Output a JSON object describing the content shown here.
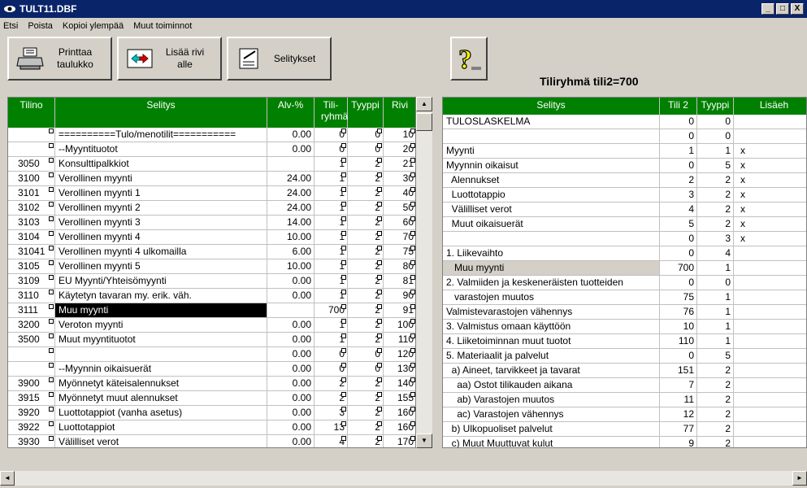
{
  "window": {
    "title": "TULT11.DBF",
    "min": "_",
    "max": "□",
    "close": "X"
  },
  "menu": [
    "Etsi",
    "Poista",
    "Kopioi ylempää",
    "Muut toiminnot"
  ],
  "toolbar": {
    "print": [
      "Printtaa",
      "taulukko"
    ],
    "addrow": [
      "Lisää rivi",
      "alle"
    ],
    "explain": "Selitykset"
  },
  "group_title": "Tiliryhmä tili2=700",
  "left": {
    "headers": [
      "Tilino",
      "Selitys",
      "Alv-%",
      "Tili-ryhmä",
      "Tyyppi",
      "Rivi"
    ],
    "rows": [
      [
        "",
        "==========Tulo/menotilit===========",
        "0.00",
        "0",
        "0",
        "10"
      ],
      [
        "",
        "--Myyntituotot",
        "0.00",
        "0",
        "0",
        "20"
      ],
      [
        "3050",
        "Konsulttipalkkiot",
        "",
        "1",
        "2",
        "21"
      ],
      [
        "3100",
        "Verollinen myynti",
        "24.00",
        "1",
        "2",
        "30"
      ],
      [
        "3101",
        "Verollinen myynti 1",
        "24.00",
        "1",
        "2",
        "40"
      ],
      [
        "3102",
        "Verollinen myynti 2",
        "24.00",
        "1",
        "2",
        "50"
      ],
      [
        "3103",
        "Verollinen myynti 3",
        "14.00",
        "1",
        "2",
        "60"
      ],
      [
        "3104",
        "Verollinen myynti 4",
        "10.00",
        "1",
        "2",
        "70"
      ],
      [
        "31041",
        "Verollinen myynti 4 ulkomailla",
        "6.00",
        "1",
        "2",
        "75"
      ],
      [
        "3105",
        "Verollinen myynti 5",
        "10.00",
        "1",
        "2",
        "80"
      ],
      [
        "3109",
        "EU Myynti/Yhteisömyynti",
        "0.00",
        "1",
        "2",
        "81"
      ],
      [
        "3110",
        "Käytetyn tavaran my. erik. väh.",
        "0.00",
        "1",
        "2",
        "90"
      ],
      [
        "3111",
        "Muu myynti",
        "",
        "700",
        "2",
        "91"
      ],
      [
        "3200",
        "Veroton myynti",
        "0.00",
        "1",
        "2",
        "100"
      ],
      [
        "3500",
        "Muut myyntituotot",
        "0.00",
        "1",
        "2",
        "110"
      ],
      [
        "",
        "",
        "0.00",
        "0",
        "0",
        "120"
      ],
      [
        "",
        "--Myynnin oikaisuerät",
        "0.00",
        "0",
        "0",
        "130"
      ],
      [
        "3900",
        "Myönnetyt käteisalennukset",
        "0.00",
        "2",
        "2",
        "140"
      ],
      [
        "3915",
        "Myönnetyt muut alennukset",
        "0.00",
        "2",
        "2",
        "155"
      ],
      [
        "3920",
        "Luottotappiot (vanha asetus)",
        "0.00",
        "3",
        "2",
        "160"
      ],
      [
        "3922",
        "Luottotappiot",
        "0.00",
        "13",
        "2",
        "160"
      ],
      [
        "3930",
        "Välilliset verot",
        "0.00",
        "4",
        "2",
        "170"
      ]
    ]
  },
  "right": {
    "headers": [
      "Selitys",
      "Tili 2",
      "Tyyppi",
      "Lisäeh"
    ],
    "rows": [
      [
        "TULOSLASKELMA",
        "0",
        "0",
        ""
      ],
      [
        "",
        "0",
        "0",
        ""
      ],
      [
        "Myynti",
        "1",
        "1",
        "x"
      ],
      [
        "Myynnin oikaisut",
        "0",
        "5",
        "x"
      ],
      [
        "  Alennukset",
        "2",
        "2",
        "x"
      ],
      [
        "  Luottotappio",
        "3",
        "2",
        "x"
      ],
      [
        "  Välilliset verot",
        "4",
        "2",
        "x"
      ],
      [
        "  Muut oikaisuerät",
        "5",
        "2",
        "x"
      ],
      [
        "",
        "0",
        "3",
        "x"
      ],
      [
        "1. Liikevaihto",
        "0",
        "4",
        ""
      ],
      [
        "   Muu myynti",
        "700",
        "1",
        ""
      ],
      [
        "2. Valmiiden ja keskeneräisten tuotteiden",
        "0",
        "0",
        ""
      ],
      [
        "   varastojen muutos",
        "75",
        "1",
        ""
      ],
      [
        "Valmistevarastojen vähennys",
        "76",
        "1",
        ""
      ],
      [
        "3. Valmistus omaan käyttöön",
        "10",
        "1",
        ""
      ],
      [
        "4. Liiketoiminnan muut tuotot",
        "110",
        "1",
        ""
      ],
      [
        "5. Materiaalit ja palvelut",
        "0",
        "5",
        ""
      ],
      [
        "  a) Aineet, tarvikkeet ja tavarat",
        "151",
        "2",
        ""
      ],
      [
        "    aa) Ostot tilikauden aikana",
        "7",
        "2",
        ""
      ],
      [
        "    ab) Varastojen muutos",
        "11",
        "2",
        ""
      ],
      [
        "    ac) Varastojen vähennys",
        "12",
        "2",
        ""
      ],
      [
        "  b) Ulkopuoliset palvelut",
        "77",
        "2",
        ""
      ],
      [
        "  c) Muut Muuttuvat kulut",
        "9",
        "2",
        ""
      ]
    ]
  }
}
